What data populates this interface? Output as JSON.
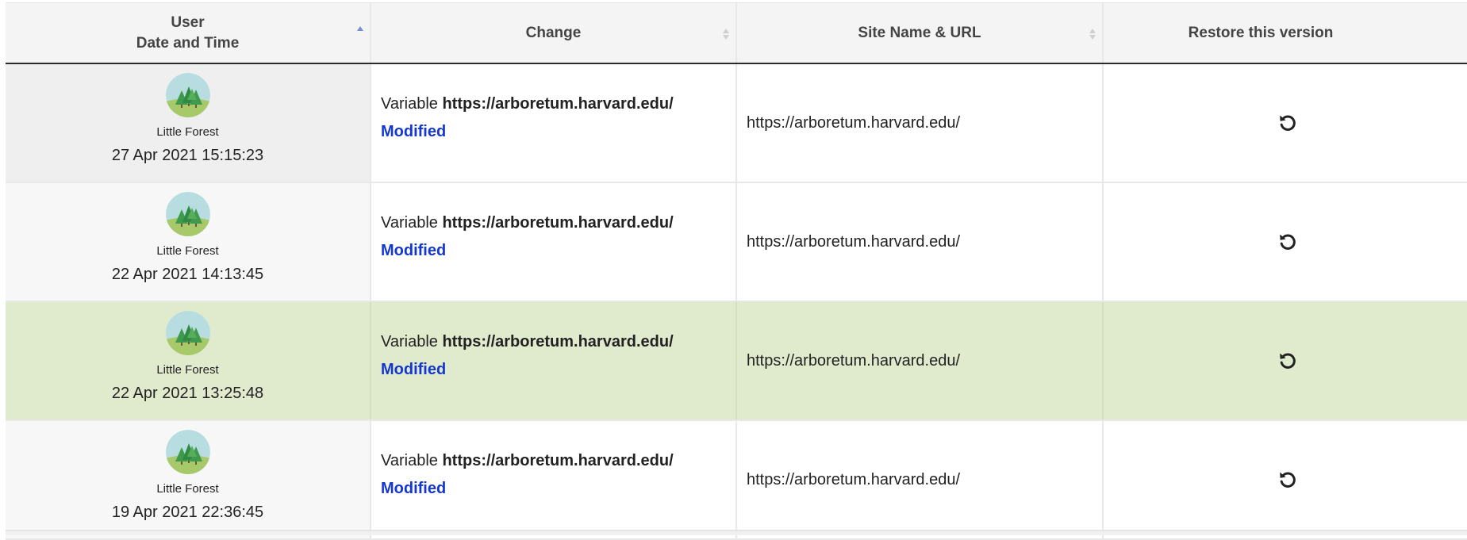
{
  "table": {
    "headers": {
      "user_line1": "User",
      "user_line2": "Date and Time",
      "change": "Change",
      "site": "Site Name & URL",
      "restore": "Restore this version"
    },
    "rows": [
      {
        "user": "Little Forest",
        "datetime": "27 Apr 2021 15:15:23",
        "change_prefix": "Variable",
        "change_url": "https://arboretum.harvard.edu/",
        "change_status": "Modified",
        "site_url": "https://arboretum.harvard.edu/"
      },
      {
        "user": "Little Forest",
        "datetime": "22 Apr 2021 14:13:45",
        "change_prefix": "Variable",
        "change_url": "https://arboretum.harvard.edu/",
        "change_status": "Modified",
        "site_url": "https://arboretum.harvard.edu/"
      },
      {
        "user": "Little Forest",
        "datetime": "22 Apr 2021 13:25:48",
        "change_prefix": "Variable",
        "change_url": "https://arboretum.harvard.edu/",
        "change_status": "Modified",
        "site_url": "https://arboretum.harvard.edu/"
      },
      {
        "user": "Little Forest",
        "datetime": "19 Apr 2021 22:36:45",
        "change_prefix": "Variable",
        "change_url": "https://arboretum.harvard.edu/",
        "change_status": "Modified",
        "site_url": "https://arboretum.harvard.edu/"
      }
    ]
  },
  "icons": {
    "avatar": "forest-avatar-icon",
    "restore": "restore-icon",
    "sort_active": "sort-asc-icon",
    "sort_inactive": "sort-both-icon"
  },
  "colors": {
    "highlight_row": "#e0ebcd",
    "status_link": "#1437d1",
    "header_bg": "#f4f4f4",
    "sort_active": "#7a8fd0"
  }
}
